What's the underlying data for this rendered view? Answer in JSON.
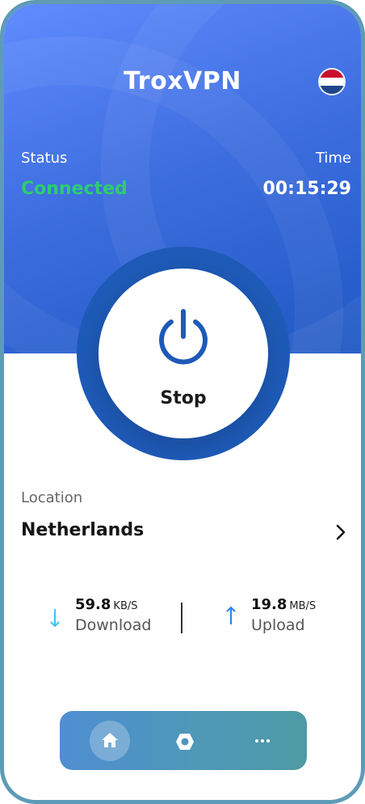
{
  "app": {
    "title": "TroxVPN"
  },
  "status": {
    "label": "Status",
    "value": "Connected",
    "color": "#2ecc71"
  },
  "time": {
    "label": "Time",
    "value": "00:15:29"
  },
  "power_button": {
    "label": "Stop",
    "icon": "power-icon"
  },
  "location": {
    "label": "Location",
    "value": "Netherlands",
    "flag_colors": [
      "#c8102e",
      "#ffffff",
      "#21468b"
    ]
  },
  "stats": {
    "download": {
      "value": "59.8",
      "unit": "KB/S",
      "label": "Download",
      "icon": "arrow-down-icon",
      "color": "#36c5f0"
    },
    "upload": {
      "value": "19.8",
      "unit": "MB/S",
      "label": "Upload",
      "icon": "arrow-up-icon",
      "color": "#2f7fe8"
    }
  },
  "nav": {
    "items": [
      "home-icon",
      "hexagon-icon",
      "more-icon"
    ],
    "active": "home-icon"
  },
  "colors": {
    "accent": "#1e5ab7",
    "frame": "#5d9bb7"
  }
}
